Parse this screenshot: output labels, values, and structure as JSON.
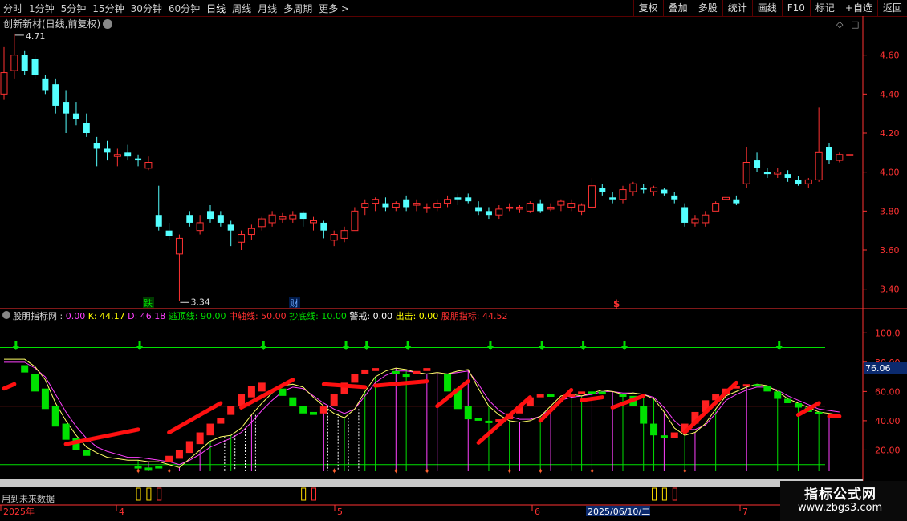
{
  "toolbar": {
    "periods": [
      "分时",
      "1分钟",
      "5分钟",
      "15分钟",
      "30分钟",
      "60分钟",
      "日线",
      "周线",
      "月线",
      "多周期",
      "更多 >"
    ],
    "active_period": "日线",
    "right_buttons": [
      "复权",
      "叠加",
      "多股",
      "统计",
      "画线",
      "F10",
      "标记",
      "+自选",
      "返回"
    ]
  },
  "main_panel": {
    "title": "创新新材(日线,前复权)",
    "high_label": "4.71",
    "low_label": "3.34",
    "markers": [
      "跌",
      "财",
      "$"
    ]
  },
  "indicator_panel": {
    "name": "股朋指标网",
    "values": [
      {
        "label": "",
        "value": "0.00",
        "color": "#ff40ff"
      },
      {
        "label": "K:",
        "value": "44.17",
        "color": "#ffff00"
      },
      {
        "label": "D:",
        "value": "46.18",
        "color": "#ff40ff"
      },
      {
        "label": "逃顶线:",
        "value": "90.00",
        "color": "#00e000"
      },
      {
        "label": "中轴线:",
        "value": "50.00",
        "color": "#ff3030"
      },
      {
        "label": "抄底线:",
        "value": "10.00",
        "color": "#00e000"
      },
      {
        "label": "警戒:",
        "value": "0.00",
        "color": "#ffffff"
      },
      {
        "label": "出击:",
        "value": "0.00",
        "color": "#ffff00"
      },
      {
        "label": "股朋指标:",
        "value": "44.52",
        "color": "#ff3030"
      }
    ],
    "current_value": "76.06"
  },
  "price_axis": [
    "4.60",
    "4.40",
    "4.20",
    "4.00",
    "3.80",
    "3.60",
    "3.40"
  ],
  "indicator_axis": [
    "100.0",
    "80.00",
    "60.00",
    "40.00",
    "20.00"
  ],
  "bottom": {
    "future_data": "用到未来数据",
    "dates": [
      "2025年",
      "4",
      "5",
      "6",
      "2025/06/10/二",
      "7"
    ]
  },
  "watermark": {
    "title": "指标公式网",
    "url": "www.zbgs3.com"
  },
  "colors": {
    "up": "#ff3232",
    "down": "#54ffff",
    "axis": "#ff3232",
    "green": "#00e000"
  },
  "chart_data": {
    "type": "candlestick",
    "ohlc": [
      [
        4.4,
        4.64,
        4.37,
        4.51
      ],
      [
        4.52,
        4.71,
        4.48,
        4.6
      ],
      [
        4.6,
        4.62,
        4.5,
        4.52
      ],
      [
        4.58,
        4.6,
        4.48,
        4.5
      ],
      [
        4.48,
        4.5,
        4.4,
        4.42
      ],
      [
        4.45,
        4.48,
        4.3,
        4.34
      ],
      [
        4.36,
        4.42,
        4.2,
        4.3
      ],
      [
        4.3,
        4.36,
        4.24,
        4.27
      ],
      [
        4.25,
        4.3,
        4.18,
        4.2
      ],
      [
        4.15,
        4.18,
        4.03,
        4.12
      ],
      [
        4.12,
        4.16,
        4.06,
        4.1
      ],
      [
        4.08,
        4.12,
        4.03,
        4.09
      ],
      [
        4.1,
        4.14,
        4.06,
        4.08
      ],
      [
        4.07,
        4.09,
        4.03,
        4.06
      ],
      [
        4.02,
        4.08,
        4.01,
        4.05
      ],
      [
        3.78,
        3.93,
        3.7,
        3.72
      ],
      [
        3.7,
        3.74,
        3.65,
        3.67
      ],
      [
        3.58,
        3.68,
        3.34,
        3.66
      ],
      [
        3.78,
        3.8,
        3.72,
        3.74
      ],
      [
        3.7,
        3.78,
        3.68,
        3.74
      ],
      [
        3.8,
        3.83,
        3.74,
        3.76
      ],
      [
        3.78,
        3.8,
        3.72,
        3.74
      ],
      [
        3.73,
        3.75,
        3.62,
        3.7
      ],
      [
        3.64,
        3.7,
        3.6,
        3.68
      ],
      [
        3.68,
        3.73,
        3.65,
        3.71
      ],
      [
        3.72,
        3.77,
        3.7,
        3.76
      ],
      [
        3.74,
        3.8,
        3.72,
        3.78
      ],
      [
        3.76,
        3.79,
        3.74,
        3.77
      ],
      [
        3.76,
        3.8,
        3.74,
        3.78
      ],
      [
        3.79,
        3.8,
        3.72,
        3.76
      ],
      [
        3.74,
        3.77,
        3.7,
        3.75
      ],
      [
        3.74,
        3.75,
        3.66,
        3.7
      ],
      [
        3.65,
        3.7,
        3.62,
        3.68
      ],
      [
        3.66,
        3.72,
        3.64,
        3.7
      ],
      [
        3.7,
        3.82,
        3.7,
        3.8
      ],
      [
        3.82,
        3.86,
        3.78,
        3.84
      ],
      [
        3.84,
        3.87,
        3.8,
        3.86
      ],
      [
        3.84,
        3.87,
        3.8,
        3.82
      ],
      [
        3.82,
        3.85,
        3.8,
        3.84
      ],
      [
        3.86,
        3.88,
        3.8,
        3.82
      ],
      [
        3.83,
        3.86,
        3.8,
        3.84
      ],
      [
        3.82,
        3.84,
        3.79,
        3.82
      ],
      [
        3.82,
        3.86,
        3.8,
        3.84
      ],
      [
        3.84,
        3.88,
        3.82,
        3.86
      ],
      [
        3.87,
        3.89,
        3.83,
        3.86
      ],
      [
        3.87,
        3.89,
        3.84,
        3.85
      ],
      [
        3.82,
        3.85,
        3.78,
        3.8
      ],
      [
        3.8,
        3.82,
        3.76,
        3.78
      ],
      [
        3.78,
        3.83,
        3.76,
        3.81
      ],
      [
        3.82,
        3.84,
        3.8,
        3.82
      ],
      [
        3.81,
        3.83,
        3.79,
        3.82
      ],
      [
        3.8,
        3.85,
        3.79,
        3.84
      ],
      [
        3.84,
        3.86,
        3.79,
        3.8
      ],
      [
        3.81,
        3.84,
        3.8,
        3.82
      ],
      [
        3.83,
        3.86,
        3.8,
        3.85
      ],
      [
        3.82,
        3.86,
        3.8,
        3.84
      ],
      [
        3.8,
        3.84,
        3.78,
        3.83
      ],
      [
        3.82,
        3.97,
        3.82,
        3.93
      ],
      [
        3.92,
        3.94,
        3.88,
        3.9
      ],
      [
        3.87,
        3.9,
        3.84,
        3.86
      ],
      [
        3.86,
        3.93,
        3.84,
        3.91
      ],
      [
        3.9,
        3.95,
        3.88,
        3.94
      ],
      [
        3.92,
        3.94,
        3.89,
        3.91
      ],
      [
        3.9,
        3.93,
        3.88,
        3.92
      ],
      [
        3.91,
        3.92,
        3.88,
        3.89
      ],
      [
        3.88,
        3.9,
        3.84,
        3.86
      ],
      [
        3.82,
        3.84,
        3.72,
        3.74
      ],
      [
        3.74,
        3.78,
        3.72,
        3.76
      ],
      [
        3.74,
        3.8,
        3.72,
        3.78
      ],
      [
        3.8,
        3.85,
        3.8,
        3.84
      ],
      [
        3.86,
        3.88,
        3.82,
        3.87
      ],
      [
        3.86,
        3.88,
        3.83,
        3.84
      ],
      [
        3.94,
        4.13,
        3.92,
        4.05
      ],
      [
        4.06,
        4.1,
        4.0,
        4.02
      ],
      [
        4.0,
        4.02,
        3.97,
        3.99
      ],
      [
        3.99,
        4.02,
        3.97,
        4.0
      ],
      [
        3.99,
        4.01,
        3.95,
        3.97
      ],
      [
        3.96,
        3.98,
        3.93,
        3.94
      ],
      [
        3.94,
        3.97,
        3.92,
        3.96
      ],
      [
        3.96,
        4.33,
        3.95,
        4.1
      ],
      [
        4.13,
        4.15,
        4.04,
        4.06
      ],
      [
        4.06,
        4.1,
        4.05,
        4.09
      ],
      [
        4.09,
        4.09,
        4.09,
        4.09
      ]
    ],
    "k_series": [
      [
        0,
        82
      ],
      [
        2,
        82
      ],
      [
        3,
        77
      ],
      [
        4,
        68
      ],
      [
        5,
        52
      ],
      [
        6,
        40
      ],
      [
        7,
        30
      ],
      [
        8,
        22
      ],
      [
        9,
        18
      ],
      [
        10,
        15
      ],
      [
        11,
        14
      ],
      [
        12,
        13
      ],
      [
        13,
        13
      ],
      [
        14,
        12
      ],
      [
        15,
        12
      ],
      [
        16,
        10
      ],
      [
        17,
        8
      ],
      [
        18,
        14
      ],
      [
        19,
        20
      ],
      [
        20,
        26
      ],
      [
        21,
        29
      ],
      [
        22,
        30
      ],
      [
        23,
        35
      ],
      [
        24,
        44
      ],
      [
        25,
        52
      ],
      [
        26,
        59
      ],
      [
        27,
        64
      ],
      [
        28,
        65
      ],
      [
        29,
        63
      ],
      [
        30,
        56
      ],
      [
        31,
        50
      ],
      [
        32,
        45
      ],
      [
        33,
        42
      ],
      [
        34,
        48
      ],
      [
        35,
        60
      ],
      [
        36,
        70
      ],
      [
        37,
        74
      ],
      [
        38,
        76
      ],
      [
        39,
        75
      ],
      [
        40,
        73
      ],
      [
        41,
        72
      ],
      [
        42,
        73
      ],
      [
        43,
        72
      ],
      [
        44,
        74
      ],
      [
        45,
        75
      ],
      [
        46,
        62
      ],
      [
        47,
        50
      ],
      [
        48,
        44
      ],
      [
        49,
        40
      ],
      [
        50,
        39
      ],
      [
        51,
        40
      ],
      [
        52,
        43
      ],
      [
        53,
        50
      ],
      [
        54,
        57
      ],
      [
        55,
        58
      ],
      [
        56,
        57
      ],
      [
        57,
        59
      ],
      [
        58,
        61
      ],
      [
        59,
        60
      ],
      [
        60,
        58
      ],
      [
        61,
        59
      ],
      [
        62,
        58
      ],
      [
        63,
        55
      ],
      [
        64,
        46
      ],
      [
        65,
        35
      ],
      [
        66,
        30
      ],
      [
        67,
        32
      ],
      [
        68,
        38
      ],
      [
        69,
        48
      ],
      [
        70,
        57
      ],
      [
        71,
        60
      ],
      [
        72,
        63
      ],
      [
        73,
        65
      ],
      [
        74,
        64
      ],
      [
        75,
        60
      ],
      [
        76,
        55
      ],
      [
        77,
        52
      ],
      [
        78,
        49
      ],
      [
        79,
        46
      ],
      [
        80,
        45
      ],
      [
        81,
        44
      ]
    ],
    "d_series": [
      [
        0,
        80
      ],
      [
        2,
        80
      ],
      [
        3,
        76
      ],
      [
        4,
        70
      ],
      [
        5,
        58
      ],
      [
        6,
        46
      ],
      [
        7,
        36
      ],
      [
        8,
        28
      ],
      [
        9,
        22
      ],
      [
        10,
        19
      ],
      [
        11,
        17
      ],
      [
        12,
        15
      ],
      [
        13,
        15
      ],
      [
        14,
        14
      ],
      [
        15,
        13
      ],
      [
        16,
        12
      ],
      [
        17,
        10
      ],
      [
        18,
        13
      ],
      [
        19,
        17
      ],
      [
        20,
        22
      ],
      [
        21,
        25
      ],
      [
        22,
        28
      ],
      [
        23,
        32
      ],
      [
        24,
        39
      ],
      [
        25,
        47
      ],
      [
        26,
        54
      ],
      [
        27,
        60
      ],
      [
        28,
        63
      ],
      [
        29,
        62
      ],
      [
        30,
        57
      ],
      [
        31,
        52
      ],
      [
        32,
        48
      ],
      [
        33,
        45
      ],
      [
        34,
        48
      ],
      [
        35,
        57
      ],
      [
        36,
        66
      ],
      [
        37,
        71
      ],
      [
        38,
        74
      ],
      [
        39,
        74
      ],
      [
        40,
        73
      ],
      [
        41,
        72
      ],
      [
        42,
        72
      ],
      [
        43,
        72
      ],
      [
        44,
        73
      ],
      [
        45,
        74
      ],
      [
        46,
        65
      ],
      [
        47,
        54
      ],
      [
        48,
        47
      ],
      [
        49,
        43
      ],
      [
        50,
        41
      ],
      [
        51,
        41
      ],
      [
        52,
        43
      ],
      [
        53,
        48
      ],
      [
        54,
        54
      ],
      [
        55,
        56
      ],
      [
        56,
        57
      ],
      [
        57,
        58
      ],
      [
        58,
        60
      ],
      [
        59,
        60
      ],
      [
        60,
        59
      ],
      [
        61,
        59
      ],
      [
        62,
        58
      ],
      [
        63,
        56
      ],
      [
        64,
        49
      ],
      [
        65,
        40
      ],
      [
        66,
        34
      ],
      [
        67,
        34
      ],
      [
        68,
        37
      ],
      [
        69,
        45
      ],
      [
        70,
        54
      ],
      [
        71,
        58
      ],
      [
        72,
        61
      ],
      [
        73,
        63
      ],
      [
        74,
        63
      ],
      [
        75,
        61
      ],
      [
        76,
        57
      ],
      [
        77,
        54
      ],
      [
        78,
        51
      ],
      [
        79,
        48
      ],
      [
        80,
        47
      ],
      [
        81,
        46
      ]
    ],
    "indicator_segments": [
      [
        [
          0,
          62
        ],
        [
          1,
          65
        ]
      ],
      [
        [
          6,
          24
        ],
        [
          13,
          34
        ]
      ],
      [
        [
          16,
          32
        ],
        [
          21,
          52
        ]
      ],
      [
        [
          23,
          49
        ],
        [
          28,
          68
        ]
      ],
      [
        [
          31,
          65
        ],
        [
          35,
          63
        ]
      ],
      [
        [
          36,
          64
        ],
        [
          41,
          67
        ]
      ],
      [
        [
          42,
          50
        ],
        [
          45,
          67
        ]
      ],
      [
        [
          46,
          25
        ],
        [
          51,
          56
        ]
      ],
      [
        [
          52,
          40
        ],
        [
          55,
          61
        ]
      ],
      [
        [
          56,
          54
        ],
        [
          58,
          56
        ]
      ],
      [
        [
          59,
          49
        ],
        [
          62,
          57
        ]
      ],
      [
        [
          66,
          32
        ],
        [
          71,
          66
        ]
      ],
      [
        [
          77,
          44
        ],
        [
          79,
          52
        ]
      ],
      [
        [
          80,
          43
        ],
        [
          81,
          43
        ]
      ]
    ],
    "colored_bars": [
      [
        2,
        78,
        73
      ],
      [
        3,
        72,
        60
      ],
      [
        4,
        62,
        48
      ],
      [
        5,
        50,
        36
      ],
      [
        6,
        38,
        27
      ],
      [
        7,
        28,
        20
      ],
      [
        8,
        20,
        16
      ],
      [
        13,
        9,
        8
      ],
      [
        14,
        8,
        7
      ],
      [
        15,
        9,
        8
      ],
      [
        16,
        12,
        16
      ],
      [
        17,
        14,
        20
      ],
      [
        18,
        18,
        26
      ],
      [
        19,
        24,
        32
      ],
      [
        20,
        30,
        38
      ],
      [
        21,
        38,
        42
      ],
      [
        22,
        44,
        50
      ],
      [
        23,
        50,
        58
      ],
      [
        24,
        56,
        64
      ],
      [
        25,
        60,
        66
      ],
      [
        27,
        62,
        57
      ],
      [
        28,
        56,
        50
      ],
      [
        29,
        50,
        45
      ],
      [
        30,
        46,
        44
      ],
      [
        31,
        45,
        50
      ],
      [
        32,
        50,
        58
      ],
      [
        33,
        58,
        66
      ],
      [
        34,
        66,
        72
      ],
      [
        35,
        72,
        75
      ],
      [
        36,
        74,
        76
      ],
      [
        38,
        74,
        72
      ],
      [
        39,
        72,
        70
      ],
      [
        40,
        72,
        74
      ],
      [
        41,
        74,
        76
      ],
      [
        43,
        72,
        60
      ],
      [
        44,
        62,
        48
      ],
      [
        45,
        50,
        41
      ],
      [
        46,
        42,
        40
      ],
      [
        47,
        40,
        39
      ],
      [
        48,
        39,
        41
      ],
      [
        49,
        41,
        45
      ],
      [
        50,
        45,
        50
      ],
      [
        51,
        50,
        56
      ],
      [
        52,
        56,
        58
      ],
      [
        53,
        58,
        57
      ],
      [
        55,
        57,
        58
      ],
      [
        56,
        58,
        60
      ],
      [
        57,
        60,
        60
      ],
      [
        58,
        60,
        58
      ],
      [
        60,
        58,
        57
      ],
      [
        61,
        57,
        50
      ],
      [
        62,
        50,
        38
      ],
      [
        63,
        38,
        30
      ],
      [
        64,
        30,
        28
      ],
      [
        65,
        28,
        32
      ],
      [
        66,
        32,
        38
      ],
      [
        67,
        38,
        46
      ],
      [
        68,
        46,
        54
      ],
      [
        69,
        54,
        58
      ],
      [
        70,
        58,
        62
      ],
      [
        71,
        62,
        64
      ],
      [
        72,
        64,
        65
      ],
      [
        73,
        65,
        64
      ],
      [
        74,
        64,
        60
      ],
      [
        75,
        60,
        55
      ],
      [
        76,
        55,
        52
      ],
      [
        77,
        52,
        49
      ],
      [
        78,
        49,
        46
      ],
      [
        79,
        46,
        45
      ]
    ],
    "top_arrows": [
      1,
      13,
      25,
      33,
      35,
      39,
      47,
      52,
      56,
      60,
      75
    ],
    "ylim_price": [
      3.3,
      4.8
    ],
    "ylim_indicator": [
      0,
      110
    ]
  }
}
